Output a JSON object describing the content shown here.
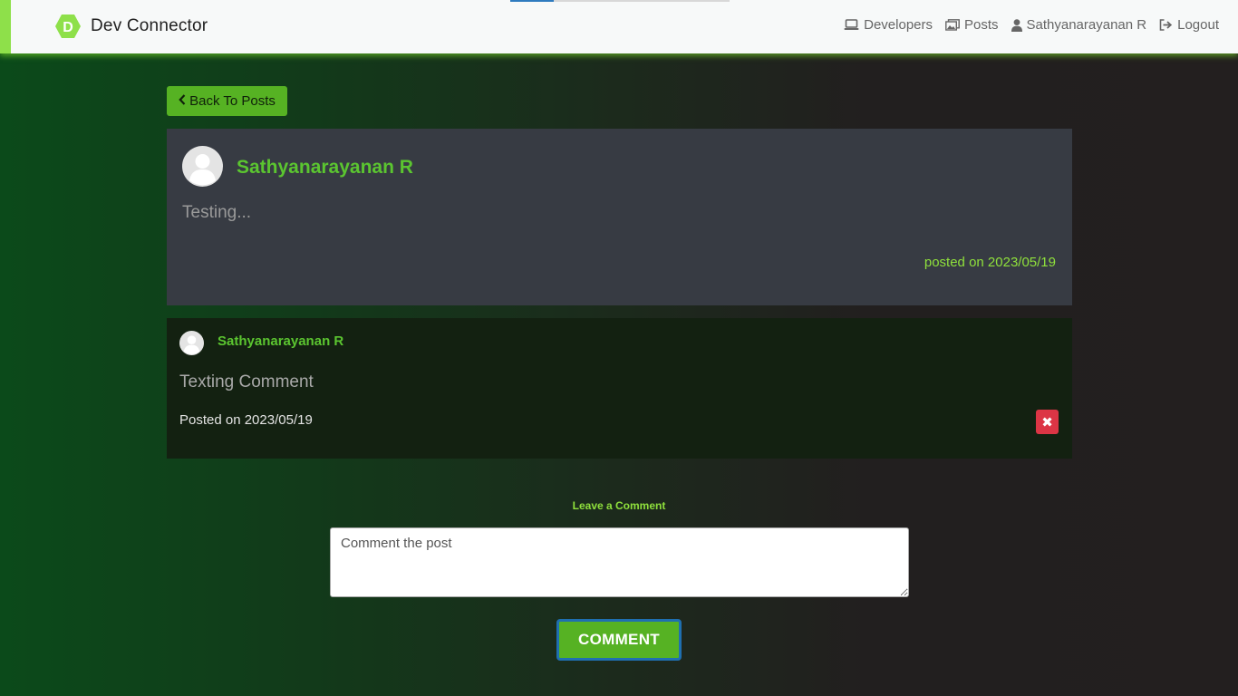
{
  "colors": {
    "accent": "#56b223",
    "accent_light": "#8fe03c",
    "author_green": "#5bc530",
    "post_card_bg": "#373b43",
    "comment_card_bg": "#132111",
    "delete_red": "#dc3545",
    "navbar_bg": "#f7f9f9"
  },
  "navbar": {
    "brand_logo_letter": "D",
    "brand_title": "Dev Connector",
    "links": [
      {
        "label": "Developers",
        "icon": "laptop-icon"
      },
      {
        "label": "Posts",
        "icon": "images-icon"
      },
      {
        "label": "Sathyanarayanan R",
        "icon": "user-icon"
      },
      {
        "label": "Logout",
        "icon": "sign-out-icon"
      }
    ]
  },
  "back_button": {
    "label": "Back To Posts",
    "icon": "chevron-left-icon"
  },
  "post": {
    "author": "Sathyanarayanan R",
    "text": "Testing...",
    "date": "posted on 2023/05/19",
    "avatar_icon": "default-avatar-icon"
  },
  "comments": [
    {
      "author": "Sathyanarayanan R",
      "text": "Texting Comment",
      "date": "Posted on 2023/05/19",
      "delete_icon": "times-icon",
      "delete_label": "✖"
    }
  ],
  "comment_form": {
    "heading": "Leave a Comment",
    "placeholder": "Comment the post",
    "submit_label": "COMMENT"
  }
}
